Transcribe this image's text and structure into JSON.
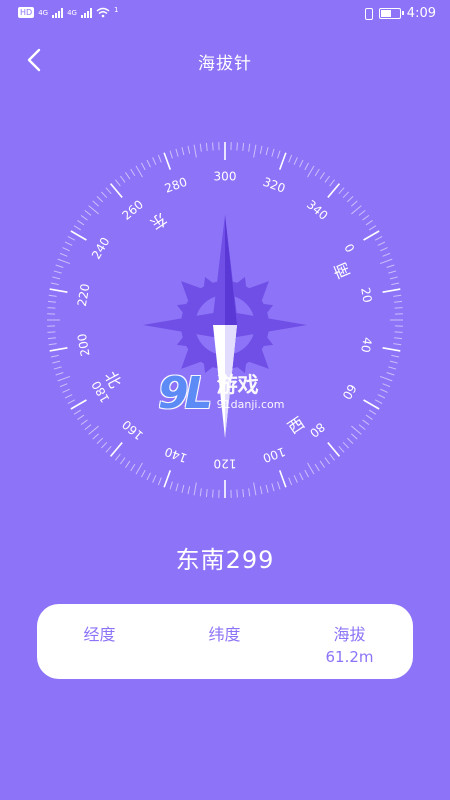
{
  "status_bar": {
    "left_badge": "HD",
    "net_1": "4G",
    "net_2": "4G",
    "wifi_sup": "1",
    "time": "4:09",
    "battery_level": 0.6
  },
  "header": {
    "title": "海拔针"
  },
  "compass": {
    "degree_labels": [
      "300",
      "320",
      "340",
      "0",
      "20",
      "40",
      "60",
      "80",
      "100",
      "120",
      "140",
      "160",
      "180",
      "200",
      "220",
      "240",
      "260",
      "280"
    ],
    "cardinal_labels": {
      "north": "北",
      "east": "东",
      "south": "南",
      "west": "西"
    },
    "rotation_deg": -60
  },
  "watermark": {
    "logo": "9L",
    "name": "游戏",
    "url": "91danji.com"
  },
  "readout": {
    "heading": "东南299"
  },
  "info_card": {
    "longitude_label": "经度",
    "longitude_value": "",
    "latitude_label": "纬度",
    "latitude_value": "",
    "altitude_label": "海拔",
    "altitude_value": "61.2m"
  },
  "colors": {
    "background": "#8d73f7",
    "compass_shape": "#6f4fe6",
    "needle_light": "#ffffff"
  }
}
